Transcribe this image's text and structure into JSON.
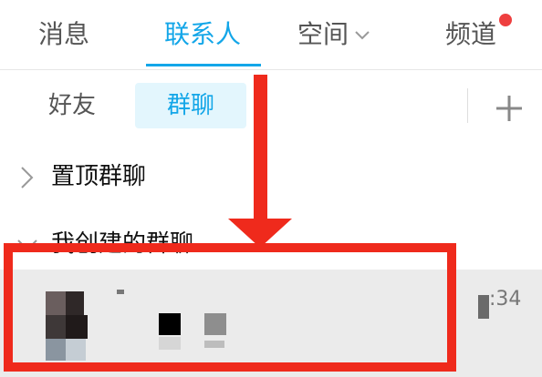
{
  "tabs": {
    "messages": "消息",
    "contacts": "联系人",
    "space": "空间",
    "channels": "频道"
  },
  "subtabs": {
    "friends": "好友",
    "groups": "群聊"
  },
  "groups": {
    "pinned": "置顶群聊",
    "created": "我创建的群聊"
  },
  "chat": {
    "time": ":34"
  },
  "colors": {
    "accent": "#13a6e8",
    "highlight": "#ef2a1c",
    "badge": "#ee3f3f"
  },
  "icons": [
    "chevron-down-icon",
    "plus-icon",
    "chevron-right-icon",
    "notification-dot-icon"
  ]
}
